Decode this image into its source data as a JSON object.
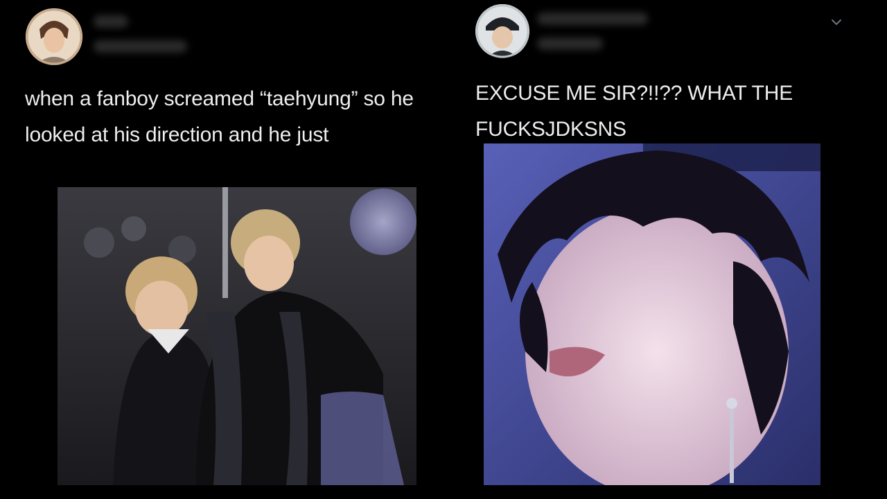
{
  "tweets": [
    {
      "avatar_icon": "user-avatar-icon",
      "text": "when a fanboy screamed “taehyung” so he looked at his direction and he just",
      "media_icon": "photo-icon"
    },
    {
      "avatar_icon": "user-avatar-icon",
      "text": "EXCUSE ME SIR?!!?? WHAT THE FUCKSJDKSNS",
      "media_icon": "photo-icon",
      "menu_icon": "chevron-down-icon"
    }
  ],
  "colors": {
    "background": "#000000",
    "text": "#eeeeee",
    "muted": "#6e767d"
  }
}
